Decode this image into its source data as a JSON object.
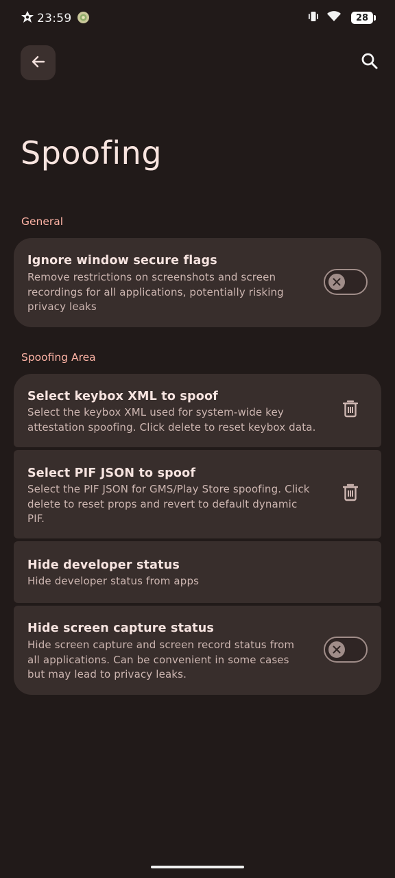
{
  "status_bar": {
    "time": "23:59",
    "battery": "28",
    "icons": [
      "notification-app-icon",
      "round-app-icon",
      "vibrate-icon",
      "wifi-icon",
      "battery-icon"
    ]
  },
  "top_bar": {
    "back_icon": "arrow-left-icon",
    "search_icon": "search-icon"
  },
  "page": {
    "title": "Spoofing"
  },
  "sections": {
    "general": {
      "label": "General",
      "items": [
        {
          "title": "Ignore window secure flags",
          "description_lines": [
            "Remove restrictions on screenshots and screen",
            "recordings for all applications, potentially risking",
            "privacy leaks"
          ],
          "control": "toggle",
          "enabled": false
        }
      ]
    },
    "spoofing_area": {
      "label": "Spoofing Area",
      "items": [
        {
          "title": "Select keybox XML to spoof",
          "description_lines": [
            "Select the keybox XML used for system-wide key",
            "attestation spoofing. Click delete to reset keybox data."
          ],
          "control": "delete",
          "icon": "trash-icon"
        },
        {
          "title": "Select PIF JSON to spoof",
          "description_lines": [
            "Select the PIF JSON for GMS/Play Store spoofing. Click",
            "delete to reset props and revert to default dynamic",
            "PIF."
          ],
          "control": "delete",
          "icon": "trash-icon"
        },
        {
          "title": "Hide developer status",
          "description_lines": [
            "Hide developer status from apps"
          ],
          "control": "none"
        },
        {
          "title": "Hide screen capture status",
          "description_lines": [
            "Hide screen capture and screen record status from",
            "all applications. Can be convenient in some cases",
            "but may lead to privacy leaks."
          ],
          "control": "toggle",
          "enabled": false
        }
      ]
    }
  },
  "colors": {
    "background": "#211a19",
    "card": "#382e2c",
    "accent": "#ffb4a6",
    "toggle_outline": "#a08d89"
  }
}
